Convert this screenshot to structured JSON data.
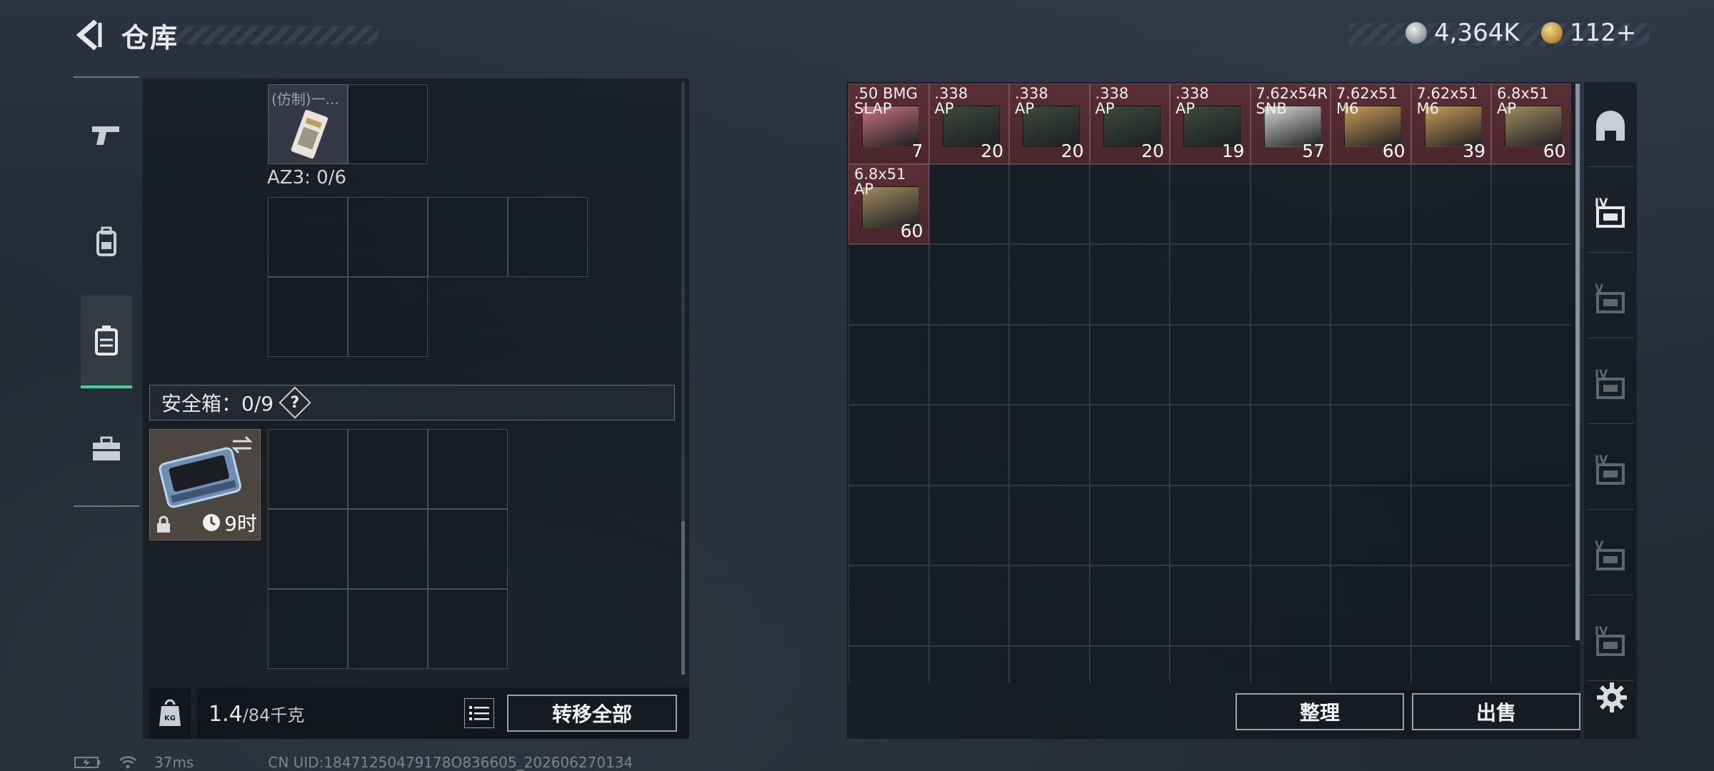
{
  "header": {
    "title": "仓库"
  },
  "currency": [
    {
      "icon": "silver-coin-icon",
      "value": "4,364K"
    },
    {
      "icon": "gold-coin-icon",
      "value": "112+"
    }
  ],
  "left_rail": [
    {
      "icon": "gun-icon",
      "active": false
    },
    {
      "icon": "backpack-icon",
      "active": false
    },
    {
      "icon": "container-icon",
      "active": true
    },
    {
      "icon": "toolbox-icon",
      "active": false
    }
  ],
  "storage": {
    "top_item_label": "(仿制)一...",
    "az3_label": "AZ3: 0/6",
    "safe_box_label": "安全箱：0/9",
    "help_label": "?",
    "case_timer": "9时"
  },
  "footer_left": {
    "weight_value": "1.4",
    "weight_max": "/84千克",
    "transfer_all_label": "转移全部"
  },
  "inventory": {
    "items": [
      {
        "name": ".50 BMG\nSLAP",
        "count": "7",
        "color": "#c9737c"
      },
      {
        "name": ".338\nAP",
        "count": "20",
        "color": "#3c4a3e"
      },
      {
        "name": ".338\nAP",
        "count": "20",
        "color": "#3c4a3e"
      },
      {
        "name": ".338\nAP",
        "count": "20",
        "color": "#3c4a3e"
      },
      {
        "name": ".338\nAP",
        "count": "19",
        "color": "#3c4a3e"
      },
      {
        "name": "7.62x54R\nSNB",
        "count": "57",
        "color": "#d6d6d2"
      },
      {
        "name": "7.62x51\nM6",
        "count": "60",
        "color": "#c89a55"
      },
      {
        "name": "7.62x51\nM6",
        "count": "39",
        "color": "#c89a55"
      },
      {
        "name": "6.8x51\nAP",
        "count": "60",
        "color": "#a08a60"
      },
      {
        "name": "6.8x51\nAP",
        "count": "60",
        "color": "#a08a60"
      }
    ],
    "sort_label": "整理",
    "sell_label": "出售"
  },
  "right_rail": [
    {
      "icon": "helmet-icon"
    },
    {
      "icon": "storage-tab-4-icon",
      "tier": "IV"
    },
    {
      "icon": "storage-tab-v-icon",
      "tier": "V"
    },
    {
      "icon": "storage-tab-iv-icon",
      "tier": "IV"
    },
    {
      "icon": "storage-tab-iv-icon",
      "tier": "IV"
    },
    {
      "icon": "storage-tab-v-icon",
      "tier": "V"
    },
    {
      "icon": "storage-tab-iv-icon",
      "tier": "IV"
    }
  ],
  "status_bar": {
    "ping": "37ms",
    "uid": "CN UID:18471250479178O836605_202606270134"
  }
}
